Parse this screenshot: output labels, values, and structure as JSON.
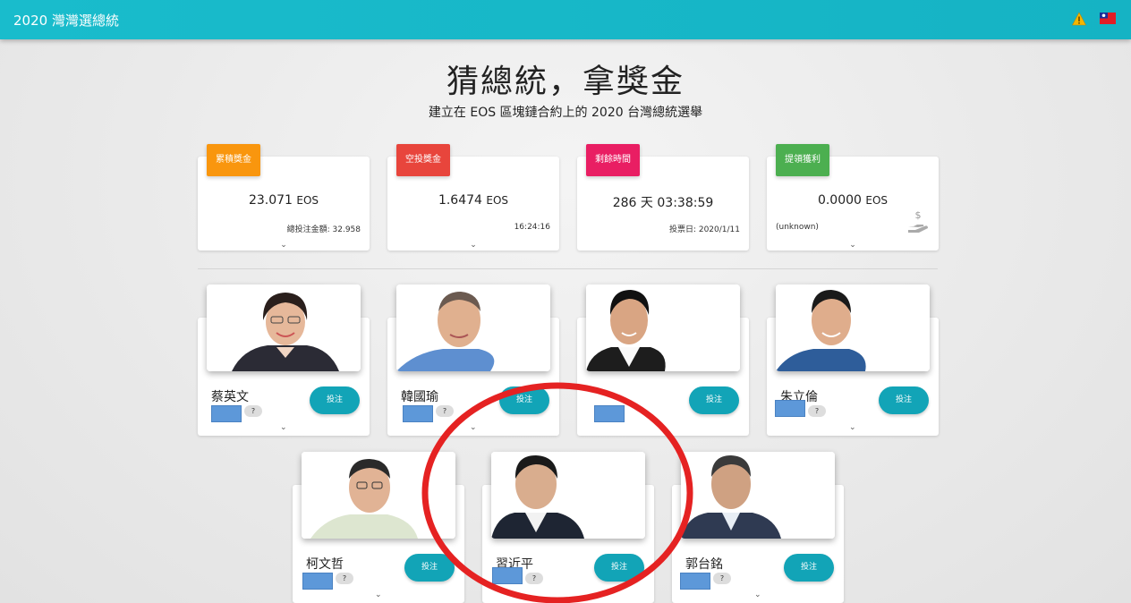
{
  "app_title": "2020 灣灣選總統",
  "headline": "猜總統，拿獎金",
  "subline": "建立在 EOS 區塊鏈合約上的 2020 台灣總統選舉",
  "colors": {
    "topbar": "#17b8c8",
    "accent_button": "#12a4b7",
    "tag_orange": "#f9960e",
    "tag_red": "#e8453c",
    "tag_pink": "#e91e63",
    "tag_green": "#4caf50",
    "highlight_circle": "#e52222"
  },
  "stats": [
    {
      "tag": "累積獎金",
      "value": "23.071",
      "unit": "EOS",
      "note": "總投注金額: 32.958"
    },
    {
      "tag": "空投獎金",
      "value": "1.6474",
      "unit": "EOS",
      "note": "16:24:16"
    },
    {
      "tag": "剩餘時間",
      "value": "286",
      "unit": "天",
      "value2": "03:38:59",
      "note": "投票日: 2020/1/11"
    },
    {
      "tag": "提領獲利",
      "value": "0.0000",
      "unit": "EOS",
      "note": "(unknown)"
    }
  ],
  "candidates": [
    {
      "name": "蔡英文",
      "bet_label": "投注",
      "badge": "?"
    },
    {
      "name": "韓國瑜",
      "bet_label": "投注",
      "badge": "?"
    },
    {
      "name": "",
      "bet_label": "投注",
      "badge": "?"
    },
    {
      "name": "朱立倫",
      "bet_label": "投注",
      "badge": "?"
    },
    {
      "name": "柯文哲",
      "bet_label": "投注",
      "badge": "?"
    },
    {
      "name": "習近平",
      "bet_label": "投注",
      "badge": "?"
    },
    {
      "name": "郭台銘",
      "bet_label": "投注",
      "badge": "?"
    }
  ],
  "icons": {
    "warning": "warning-triangle-icon",
    "flag": "taiwan-flag-icon",
    "withdraw": "hand-coin-icon",
    "chevron": "chevron-down-icon"
  }
}
